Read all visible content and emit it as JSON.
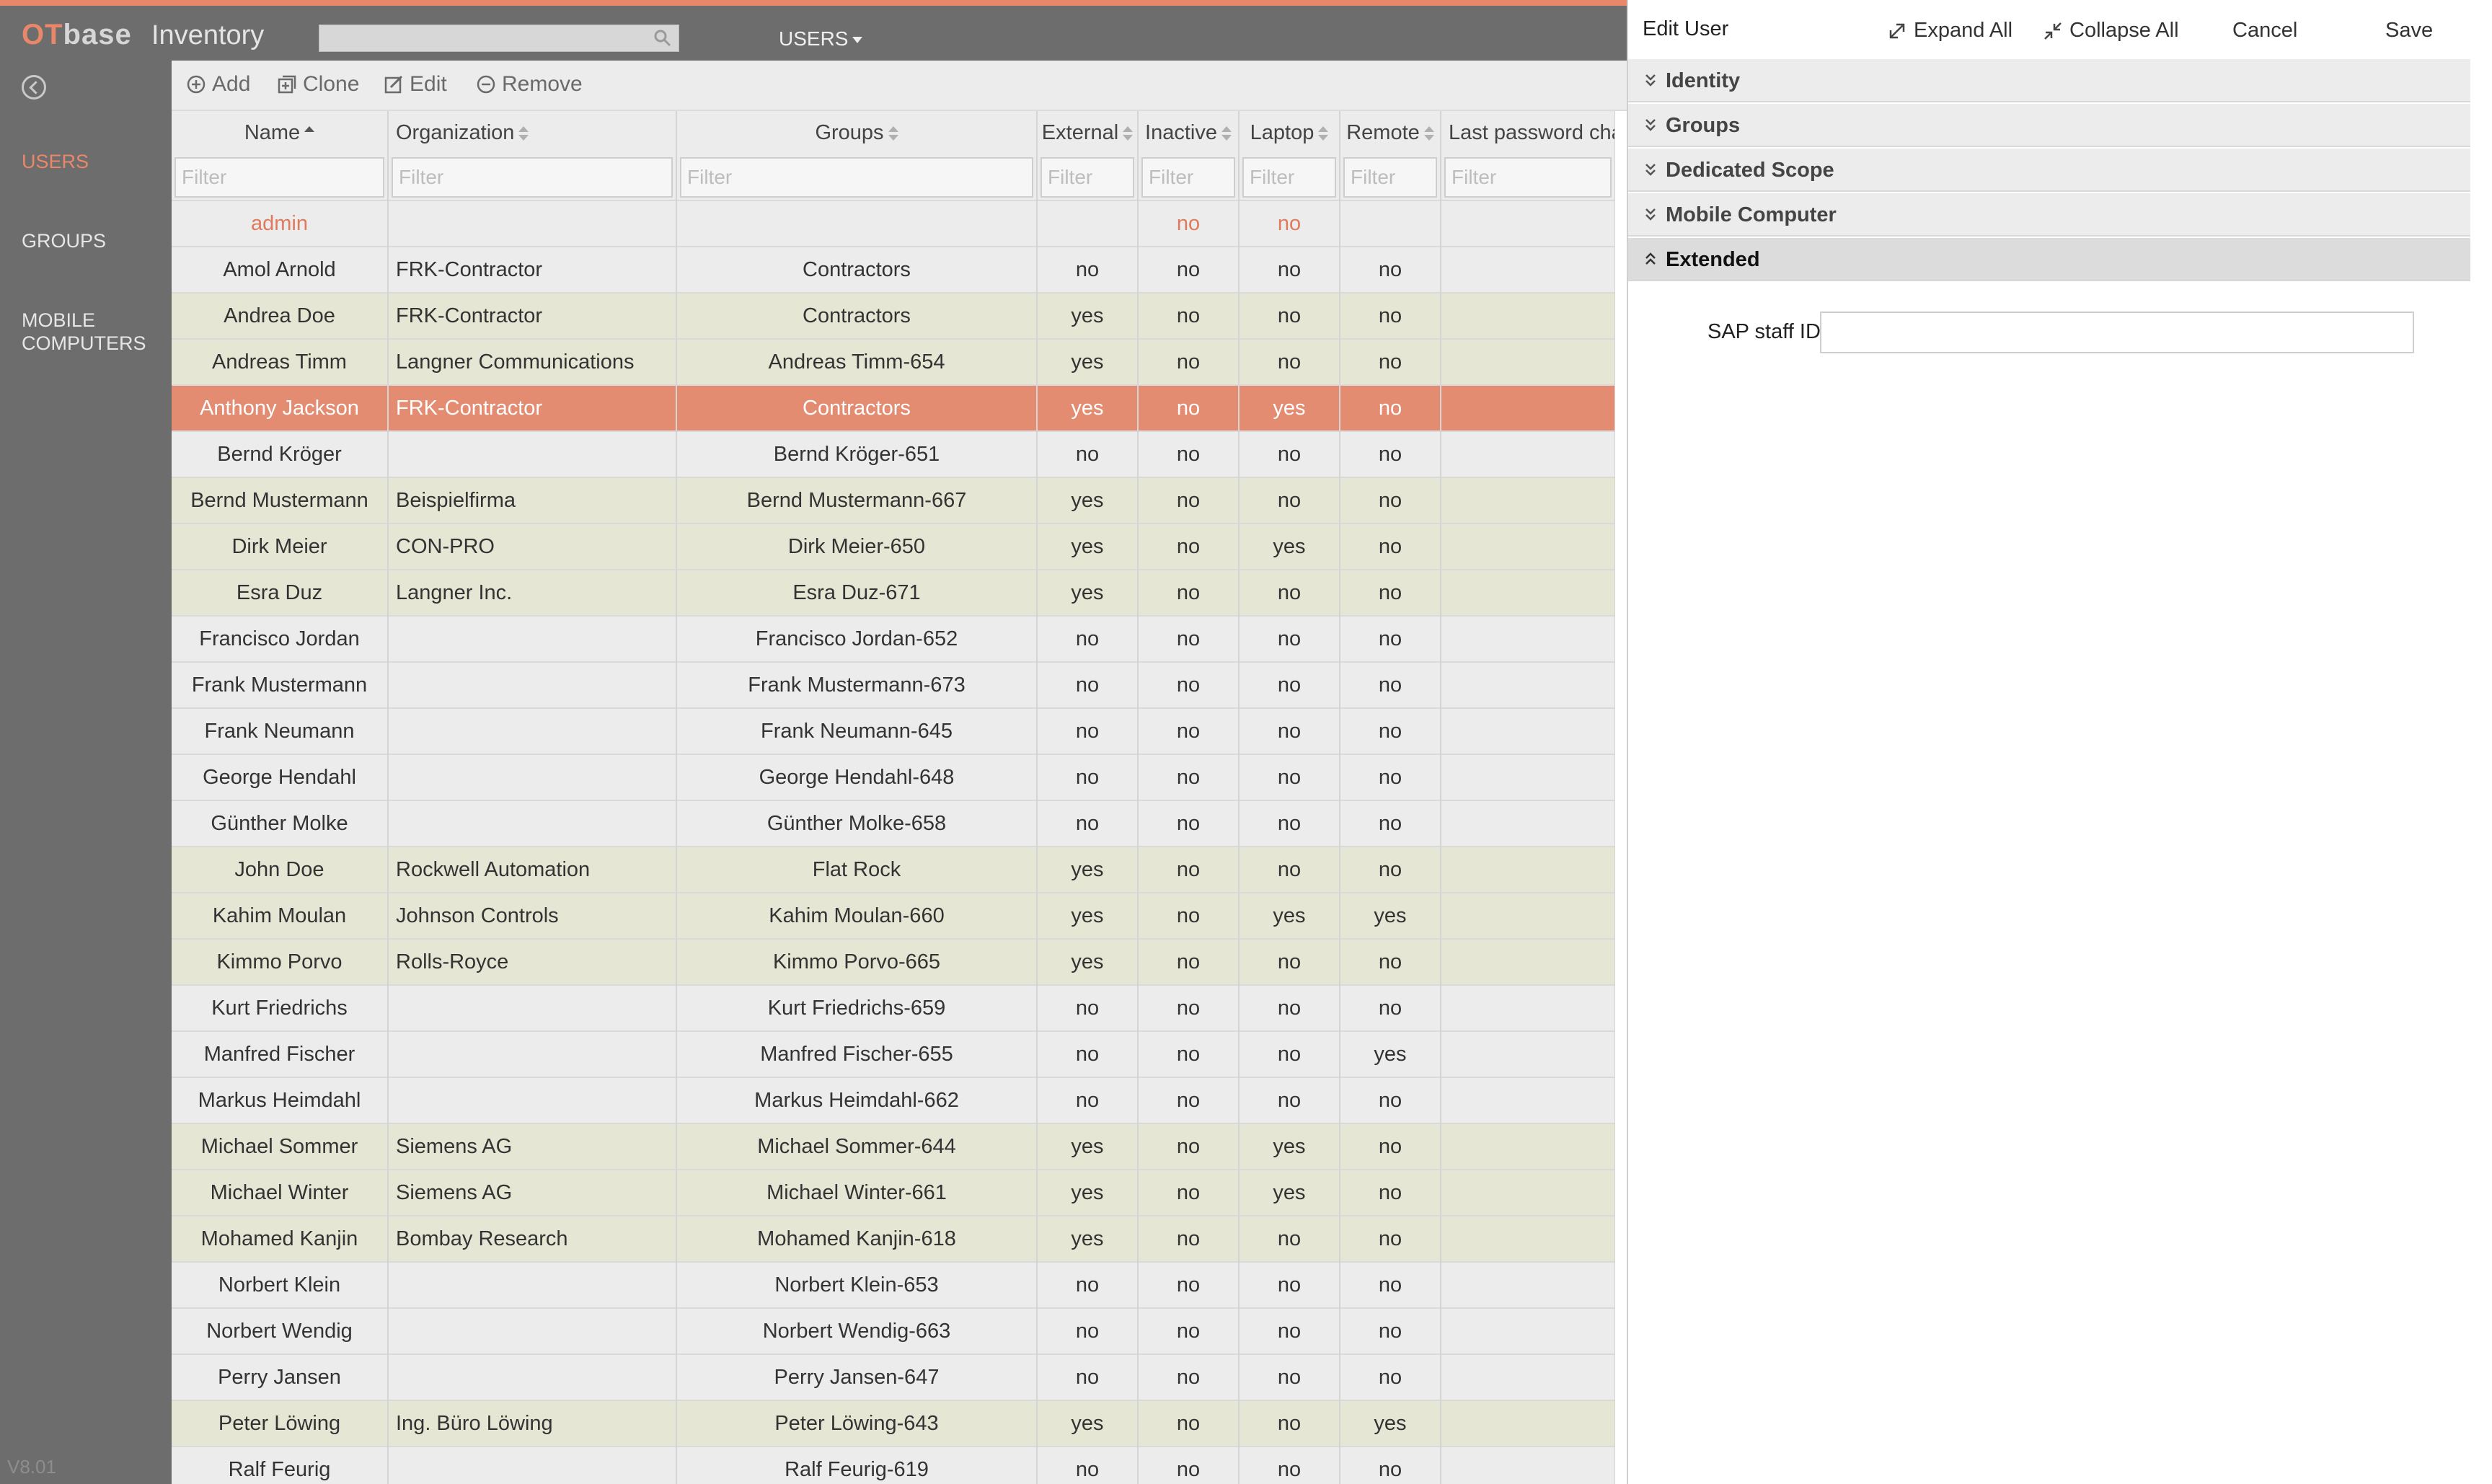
{
  "header": {
    "logo_ot": "OT",
    "logo_base": "base",
    "app_name": "Inventory",
    "search_placeholder": "",
    "nav_menu": "USERS"
  },
  "sidebar": {
    "items": [
      {
        "label": "USERS",
        "active": true
      },
      {
        "label": "GROUPS",
        "active": false
      },
      {
        "label": "MOBILE COMPUTERS",
        "active": false
      }
    ],
    "version": "V8.01"
  },
  "toolbar": {
    "add": "Add",
    "clone": "Clone",
    "edit": "Edit",
    "remove": "Remove"
  },
  "grid": {
    "columns": [
      "Name",
      "Organization",
      "Groups",
      "External",
      "Inactive",
      "Laptop",
      "Remote",
      "Last password cha"
    ],
    "sort_column": "Name",
    "filter_placeholder": "Filter",
    "rows": [
      {
        "name": "admin",
        "org": "",
        "groups": "",
        "external": "",
        "inactive": "no",
        "laptop": "no",
        "remote": "",
        "lastpw": "",
        "style": "special"
      },
      {
        "name": "Amol Arnold",
        "org": "FRK-Contractor",
        "groups": "Contractors",
        "external": "no",
        "inactive": "no",
        "laptop": "no",
        "remote": "no",
        "lastpw": "",
        "style": "plain"
      },
      {
        "name": "Andrea Doe",
        "org": "FRK-Contractor",
        "groups": "Contractors",
        "external": "yes",
        "inactive": "no",
        "laptop": "no",
        "remote": "no",
        "lastpw": "",
        "style": "external"
      },
      {
        "name": "Andreas Timm",
        "org": "Langner Communications",
        "groups": "Andreas Timm-654",
        "external": "yes",
        "inactive": "no",
        "laptop": "no",
        "remote": "no",
        "lastpw": "",
        "style": "external"
      },
      {
        "name": "Anthony Jackson",
        "org": "FRK-Contractor",
        "groups": "Contractors",
        "external": "yes",
        "inactive": "no",
        "laptop": "yes",
        "remote": "no",
        "lastpw": "",
        "style": "selected"
      },
      {
        "name": "Bernd Kröger",
        "org": "",
        "groups": "Bernd Kröger-651",
        "external": "no",
        "inactive": "no",
        "laptop": "no",
        "remote": "no",
        "lastpw": "",
        "style": "plain"
      },
      {
        "name": "Bernd Mustermann",
        "org": "Beispielfirma",
        "groups": "Bernd Mustermann-667",
        "external": "yes",
        "inactive": "no",
        "laptop": "no",
        "remote": "no",
        "lastpw": "",
        "style": "external"
      },
      {
        "name": "Dirk Meier",
        "org": "CON-PRO",
        "groups": "Dirk Meier-650",
        "external": "yes",
        "inactive": "no",
        "laptop": "yes",
        "remote": "no",
        "lastpw": "",
        "style": "external"
      },
      {
        "name": "Esra Duz",
        "org": "Langner Inc.",
        "groups": "Esra Duz-671",
        "external": "yes",
        "inactive": "no",
        "laptop": "no",
        "remote": "no",
        "lastpw": "",
        "style": "external"
      },
      {
        "name": "Francisco Jordan",
        "org": "",
        "groups": "Francisco Jordan-652",
        "external": "no",
        "inactive": "no",
        "laptop": "no",
        "remote": "no",
        "lastpw": "",
        "style": "plain"
      },
      {
        "name": "Frank Mustermann",
        "org": "",
        "groups": "Frank Mustermann-673",
        "external": "no",
        "inactive": "no",
        "laptop": "no",
        "remote": "no",
        "lastpw": "",
        "style": "plain"
      },
      {
        "name": "Frank Neumann",
        "org": "",
        "groups": "Frank Neumann-645",
        "external": "no",
        "inactive": "no",
        "laptop": "no",
        "remote": "no",
        "lastpw": "",
        "style": "plain"
      },
      {
        "name": "George Hendahl",
        "org": "",
        "groups": "George Hendahl-648",
        "external": "no",
        "inactive": "no",
        "laptop": "no",
        "remote": "no",
        "lastpw": "",
        "style": "plain"
      },
      {
        "name": "Günther Molke",
        "org": "",
        "groups": "Günther Molke-658",
        "external": "no",
        "inactive": "no",
        "laptop": "no",
        "remote": "no",
        "lastpw": "",
        "style": "plain"
      },
      {
        "name": "John Doe",
        "org": "Rockwell Automation",
        "groups": "Flat Rock",
        "external": "yes",
        "inactive": "no",
        "laptop": "no",
        "remote": "no",
        "lastpw": "",
        "style": "external"
      },
      {
        "name": "Kahim Moulan",
        "org": "Johnson Controls",
        "groups": "Kahim Moulan-660",
        "external": "yes",
        "inactive": "no",
        "laptop": "yes",
        "remote": "yes",
        "lastpw": "",
        "style": "external"
      },
      {
        "name": "Kimmo Porvo",
        "org": "Rolls-Royce",
        "groups": "Kimmo Porvo-665",
        "external": "yes",
        "inactive": "no",
        "laptop": "no",
        "remote": "no",
        "lastpw": "",
        "style": "external"
      },
      {
        "name": "Kurt Friedrichs",
        "org": "",
        "groups": "Kurt Friedrichs-659",
        "external": "no",
        "inactive": "no",
        "laptop": "no",
        "remote": "no",
        "lastpw": "",
        "style": "plain"
      },
      {
        "name": "Manfred Fischer",
        "org": "",
        "groups": "Manfred Fischer-655",
        "external": "no",
        "inactive": "no",
        "laptop": "no",
        "remote": "yes",
        "lastpw": "",
        "style": "plain"
      },
      {
        "name": "Markus Heimdahl",
        "org": "",
        "groups": "Markus Heimdahl-662",
        "external": "no",
        "inactive": "no",
        "laptop": "no",
        "remote": "no",
        "lastpw": "",
        "style": "plain"
      },
      {
        "name": "Michael Sommer",
        "org": "Siemens AG",
        "groups": "Michael Sommer-644",
        "external": "yes",
        "inactive": "no",
        "laptop": "yes",
        "remote": "no",
        "lastpw": "",
        "style": "external"
      },
      {
        "name": "Michael Winter",
        "org": "Siemens AG",
        "groups": "Michael Winter-661",
        "external": "yes",
        "inactive": "no",
        "laptop": "yes",
        "remote": "no",
        "lastpw": "",
        "style": "external"
      },
      {
        "name": "Mohamed Kanjin",
        "org": "Bombay Research",
        "groups": "Mohamed Kanjin-618",
        "external": "yes",
        "inactive": "no",
        "laptop": "no",
        "remote": "no",
        "lastpw": "",
        "style": "external"
      },
      {
        "name": "Norbert Klein",
        "org": "",
        "groups": "Norbert Klein-653",
        "external": "no",
        "inactive": "no",
        "laptop": "no",
        "remote": "no",
        "lastpw": "",
        "style": "plain"
      },
      {
        "name": "Norbert Wendig",
        "org": "",
        "groups": "Norbert Wendig-663",
        "external": "no",
        "inactive": "no",
        "laptop": "no",
        "remote": "no",
        "lastpw": "",
        "style": "plain"
      },
      {
        "name": "Perry Jansen",
        "org": "",
        "groups": "Perry Jansen-647",
        "external": "no",
        "inactive": "no",
        "laptop": "no",
        "remote": "no",
        "lastpw": "",
        "style": "plain"
      },
      {
        "name": "Peter Löwing",
        "org": "Ing. Büro Löwing",
        "groups": "Peter Löwing-643",
        "external": "yes",
        "inactive": "no",
        "laptop": "no",
        "remote": "yes",
        "lastpw": "",
        "style": "external"
      },
      {
        "name": "Ralf Feurig",
        "org": "",
        "groups": "Ralf Feurig-619",
        "external": "no",
        "inactive": "no",
        "laptop": "no",
        "remote": "no",
        "lastpw": "",
        "style": "plain"
      }
    ]
  },
  "panel": {
    "title": "Edit User",
    "expand_all": "Expand All",
    "collapse_all": "Collapse All",
    "cancel": "Cancel",
    "save": "Save",
    "sections": [
      {
        "label": "Identity",
        "open": false
      },
      {
        "label": "Groups",
        "open": false
      },
      {
        "label": "Dedicated Scope",
        "open": false
      },
      {
        "label": "Mobile Computer",
        "open": false
      },
      {
        "label": "Extended",
        "open": true
      }
    ],
    "sap_label": "SAP staff ID",
    "sap_value": ""
  },
  "colors": {
    "accent": "#e8876a",
    "selected_row": "#e38c72",
    "external_row": "#e6e6d5",
    "sidebar_bg": "#6d6d6d"
  }
}
